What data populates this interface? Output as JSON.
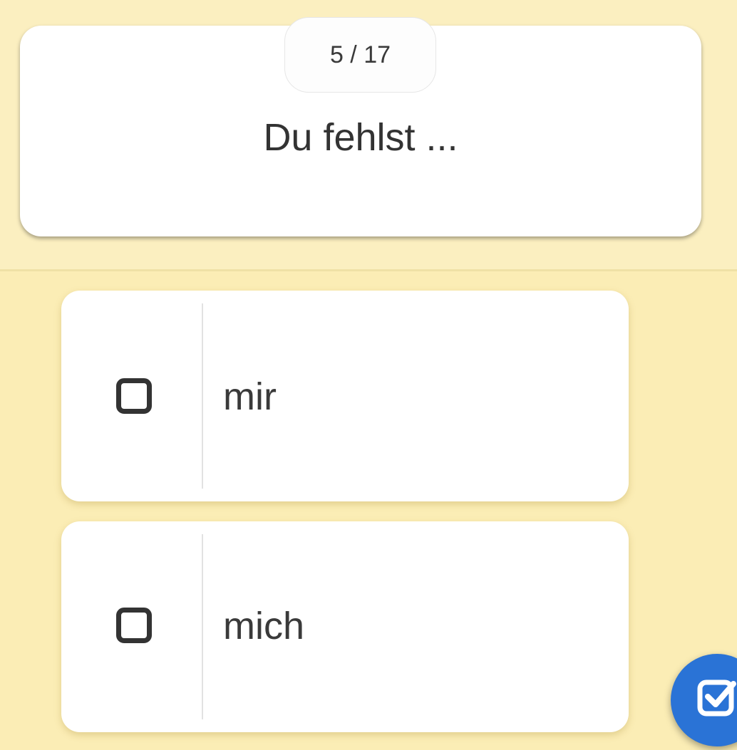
{
  "quiz": {
    "counter": "5 / 17",
    "question": "Du fehlst ..."
  },
  "options": [
    {
      "label": "mir",
      "icon": "checkbox-unchecked-icon"
    },
    {
      "label": "mich",
      "icon": "checkbox-unchecked-icon"
    }
  ],
  "submit": {
    "icon": "checkbox-checked-icon",
    "color": "#2a73d6"
  },
  "theme": {
    "background": "#fbefc0",
    "card": "#ffffff"
  }
}
